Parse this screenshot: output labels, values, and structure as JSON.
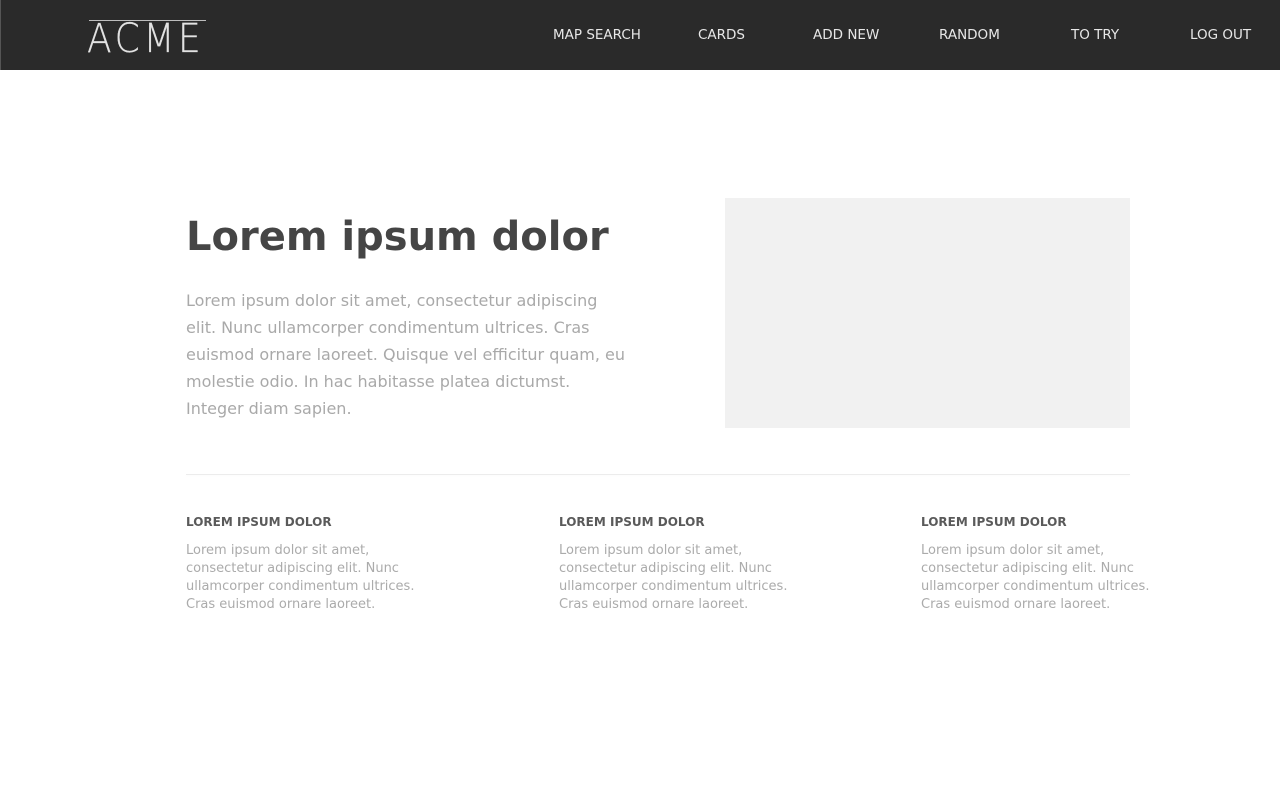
{
  "header": {
    "logo_text": "ACME",
    "nav_items": [
      {
        "label": "MAP SEARCH"
      },
      {
        "label": "CARDS"
      },
      {
        "label": "ADD NEW"
      },
      {
        "label": "RANDOM"
      },
      {
        "label": "TO TRY"
      },
      {
        "label": "LOG OUT"
      }
    ]
  },
  "hero": {
    "title": "Lorem ipsum dolor",
    "body_lines": [
      "Lorem ipsum dolor sit amet, consectetur adipiscing",
      "elit. Nunc ullamcorper condimentum ultrices. Cras",
      "euismod ornare laoreet. Quisque vel efficitur quam, eu",
      "molestie odio. In hac habitasse platea dictumst.",
      "Integer diam sapien."
    ]
  },
  "features": [
    {
      "title": "LOREM IPSUM DOLOR",
      "body_lines": [
        "Lorem ipsum dolor sit amet,",
        "consectetur adipiscing elit. Nunc",
        "ullamcorper condimentum ultrices.",
        "Cras euismod ornare laoreet."
      ]
    },
    {
      "title": "LOREM IPSUM DOLOR",
      "body_lines": [
        "Lorem ipsum dolor sit amet,",
        "consectetur adipiscing elit. Nunc",
        "ullamcorper condimentum ultrices.",
        "Cras euismod ornare laoreet."
      ]
    },
    {
      "title": "LOREM IPSUM DOLOR",
      "body_lines": [
        "Lorem ipsum dolor sit amet,",
        "consectetur adipiscing elit. Nunc",
        "ullamcorper condimentum ultrices.",
        "Cras euismod ornare laoreet."
      ]
    }
  ],
  "colors": {
    "navbar_background": "#2a2a2a",
    "nav_text": "#e7e7e7",
    "title_text": "#454545",
    "body_text": "#a9a9a9",
    "image_placeholder": "#f1f1f1"
  }
}
